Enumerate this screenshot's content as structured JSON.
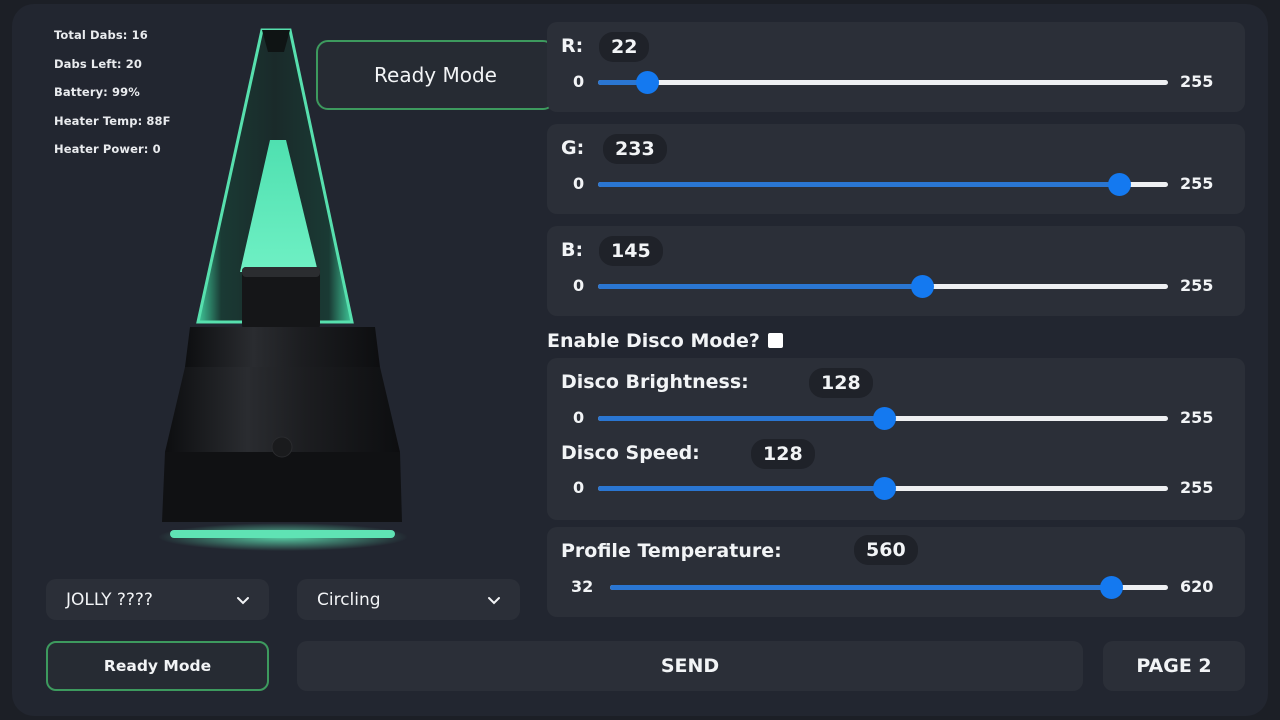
{
  "stats": [
    "Total Dabs: 16",
    "Dabs Left: 20",
    "Battery: 99%",
    "Heater Temp: 88F",
    "Heater Power: 0"
  ],
  "status_badge": "Ready Mode",
  "colors": {
    "accent_blue": "#1479f0",
    "ready_green": "#3d9a5e",
    "device_glow": "#5fe3b4"
  },
  "sliders": {
    "r": {
      "label": "R:",
      "value": "22",
      "min": "0",
      "max": "255",
      "fraction": 0.086
    },
    "g": {
      "label": "G:",
      "value": "233",
      "min": "0",
      "max": "255",
      "fraction": 0.914
    },
    "b": {
      "label": "B:",
      "value": "145",
      "min": "0",
      "max": "255",
      "fraction": 0.569
    },
    "disco_brightness": {
      "label": "Disco Brightness:",
      "value": "128",
      "min": "0",
      "max": "255",
      "fraction": 0.502
    },
    "disco_speed": {
      "label": "Disco Speed:",
      "value": "128",
      "min": "0",
      "max": "255",
      "fraction": 0.502
    },
    "profile_temp": {
      "label": "Profile Temperature:",
      "value": "560",
      "min": "32",
      "max": "620",
      "fraction": 0.898
    }
  },
  "disco_toggle": {
    "label": "Enable Disco Mode?",
    "checked": false
  },
  "selects": {
    "preset": {
      "value": "JOLLY ????",
      "icon": "chevron-down-icon"
    },
    "animation": {
      "value": "Circling",
      "icon": "chevron-down-icon"
    }
  },
  "buttons": {
    "ready_mode": "Ready Mode",
    "send": "SEND",
    "page2": "PAGE 2"
  }
}
